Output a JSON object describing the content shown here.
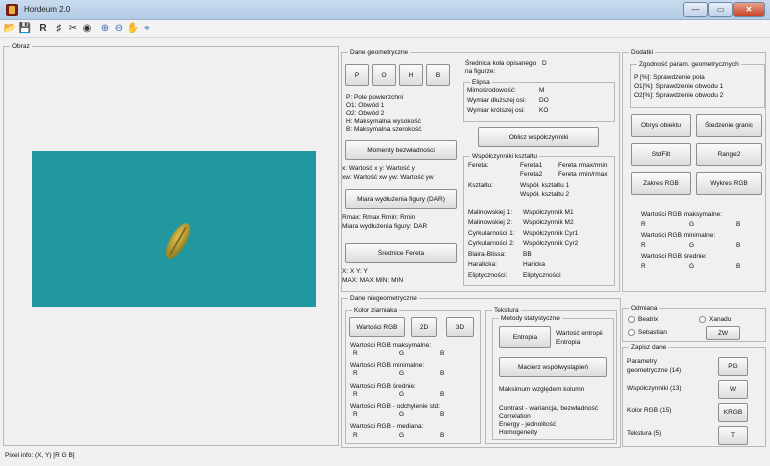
{
  "window": {
    "title": "Hordeum 2.0",
    "minimize_label": "—",
    "maximize_label": "▭",
    "close_label": "✕"
  },
  "toolbar": {
    "items": [
      {
        "icon": "open-folder-icon",
        "glyph": "📂"
      },
      {
        "icon": "save-icon",
        "glyph": "💾"
      },
      {
        "icon": "r-icon",
        "glyph": "R"
      },
      {
        "icon": "hash-icon",
        "glyph": "♯"
      },
      {
        "icon": "tools-icon",
        "glyph": "✂"
      },
      {
        "icon": "color-icon",
        "glyph": "◉"
      },
      {
        "icon": "zoom-in-icon",
        "glyph": "⊕"
      },
      {
        "icon": "zoom-out-icon",
        "glyph": "⊖"
      },
      {
        "icon": "pan-icon",
        "glyph": "✋"
      },
      {
        "icon": "data-cursor-icon",
        "glyph": "⌖"
      }
    ]
  },
  "obraz": {
    "title": "Obraz",
    "pixel_info": "Pixel info: (X, Y)  [R G B]"
  },
  "geo": {
    "title": "Dane geometryczne",
    "buttons": [
      "P",
      "O",
      "H",
      "B"
    ],
    "legend": [
      "P:  Pole powierzchni",
      "O1: Obwód 1",
      "O2: Obwód 2",
      "H:  Maksymalna wysokość",
      "B:  Maksymalna szerokość"
    ],
    "moments_btn": "Momenty bezwładności",
    "moments_line1": "x:  Wartość x    y:  Wartość y",
    "moments_line2": "xw: Wartość xw  yw: Wartość yw",
    "dar_btn": "Miara wydłużenia figury (DAR)",
    "dar_line1": "Rmax:  Rmax       Rmin:  Rmin",
    "dar_line2": "Miara wydłużenia figury:  DAR",
    "fereta_btn": "Średnice Fereta",
    "fereta_line1": "X:  X                       Y:   Y",
    "fereta_line2": "MAX:  MAX           MIN:  MIN",
    "srednica_label1": "Średnica koła opisanego",
    "srednica_label2": "na figurze:",
    "srednica_value": "D",
    "elipsa": {
      "title": "Elipsa",
      "rows": [
        {
          "label": "Mimośrodowość:",
          "value": "M"
        },
        {
          "label": "Wymiar dłuższej osi:",
          "value": "DO"
        },
        {
          "label": "Wymiar krótszej osi:",
          "value": "KO"
        }
      ]
    },
    "oblicz_btn": "Oblicz współczynniki",
    "wsp": {
      "title": "Współczynniki kształtu",
      "fereta_label": "Fereta:",
      "fereta_r1a": "Fereta1",
      "fereta_r1b": "Fereta rmax/rmin",
      "fereta_r2a": "Fereta2",
      "fereta_r2b": "Fereta rmin/rmax",
      "ksztalt_label": "Kształtu:",
      "ksztalt_1": "Współ. kształtu 1",
      "ksztalt_2": "Współ. kształtu 2",
      "rows": [
        {
          "label": "Malinowskiej 1:",
          "value": "Współczynnik M1"
        },
        {
          "label": "Malinowskiej 2:",
          "value": "Współczynnik M2"
        },
        {
          "label": "Cyrkularności 1:",
          "value": "Współczynnik Cyr1"
        },
        {
          "label": "Cyrkularności 2:",
          "value": "Współczynnik Cyr2"
        },
        {
          "label": "Blaira-Blissa:",
          "value": "BB"
        },
        {
          "label": "Haralicka:",
          "value": "Haricka"
        },
        {
          "label": "Eliptyczności:",
          "value": "Eliptyczności"
        }
      ]
    }
  },
  "dodatki": {
    "title": "Dodatki",
    "zgodnosc": {
      "title": "Zgodność param. geometrycznych",
      "lines": [
        "P [%]: Sprawdzenie pola",
        "O1[%]: Sprawdzenie obwodu 1",
        "O2[%]: Sprawdzenie obwodu 2"
      ]
    },
    "buttons": [
      "Obrys obiektu",
      "Śledzenie granic",
      "StdFilt",
      "Range2",
      "Zakres RGB",
      "Wykres RGB"
    ],
    "rgb_max_label": "Wartości RGB maksymalne:",
    "rgb_min_label": "Wartości RGB minimalne:",
    "rgb_avg_label": "Wartości RGB średnie:",
    "r": "R",
    "g": "G",
    "b": "B"
  },
  "niegeo": {
    "title": "Dane niegeometryczne",
    "kolor": {
      "title": "Kolor ziarniaka",
      "btn_rgb": "Wartości RGB",
      "btn_2d": "2D",
      "btn_3d": "3D",
      "labels": [
        "Wartości RGB maksymalne:",
        "Wartości RGB minimalne:",
        "Wartości RGB średnie:",
        "Wartości RGB - odchylenie std:",
        "Wartości RGB - mediana:"
      ],
      "r": "R",
      "g": "G",
      "b": "B"
    },
    "tekstura": {
      "title": "Tekstura",
      "metody_title": "Metody statystyczne",
      "entropia_btn": "Entropia",
      "entropia_line1": "Wartość entropii",
      "entropia_line2": "Entropia",
      "macierz_btn": "Macierz współwystąpień",
      "maksimum": "Maksimum względem kolumn",
      "contrast": "Contrast - wariancja, bezwładność",
      "correlation": "Correlation",
      "energy": "Energy - jednolitość",
      "homogeneity": "Homogeneity"
    }
  },
  "odmiana": {
    "title": "Odmiana",
    "opt1": "Beatrix",
    "opt2": "Xanadu",
    "opt3": "Sebastian",
    "zw_btn": "ZW"
  },
  "zapisz": {
    "title": "Zapisz dane",
    "rows": [
      {
        "label1": "Parametry",
        "label2": "geometryczne (14)",
        "btn": "PG"
      },
      {
        "label1": "Współczynniki (13)",
        "label2": "",
        "btn": "W"
      },
      {
        "label1": "Kolor RGB (15)",
        "label2": "",
        "btn": "KRGB"
      },
      {
        "label1": "Tekstura (5)",
        "label2": "",
        "btn": "T"
      }
    ]
  }
}
